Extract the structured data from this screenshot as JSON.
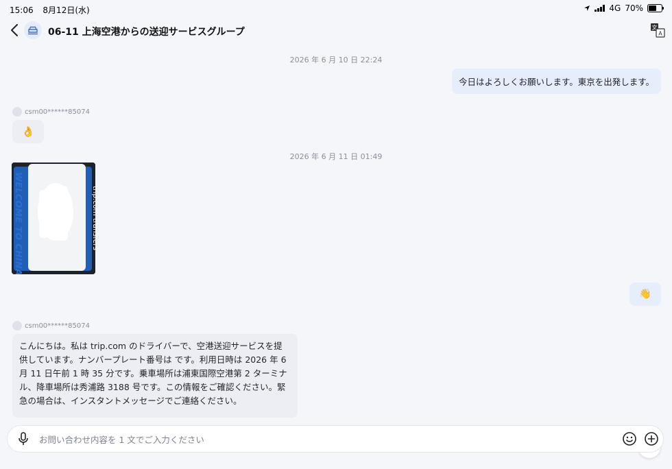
{
  "status_bar": {
    "time": "15:06",
    "date": "8月12日(水)",
    "network": "4G",
    "battery": "70%",
    "battery_level": 0.7
  },
  "header": {
    "title": "06-11 上海空港からの送迎サービスグループ",
    "back_icon": "chevron-left-icon",
    "translate_icon": "translate-icon"
  },
  "messages": {
    "ts1": "2026 年 6 月 10 日 22:24",
    "out1": "今日はよろしくお願いします。東京を出発します。",
    "sender1": "csm00******85074",
    "in1_emoji": "👌",
    "ts2": "2026 年 6 月 11 日 01:49",
    "photo": {
      "line1": "WELCOME TO CHINA",
      "line2": "trip.com transfers"
    },
    "out2_emoji": "👋",
    "sender2": "csm00******85074",
    "in2": "こんにちは。私は trip.com のドライバーで、空港送迎サービスを提供しています。ナンバープレート番号は  です。利用日時は 2026 年 6 月 11 日午前 1 時 35 分です。乗車場所は浦東国際空港第 2 ターミナル、降車場所は秀浦路 3188 号です。この情報をご確認ください。緊急の場合は、インスタントメッセージでご連絡ください。"
  },
  "composer": {
    "placeholder": "お問い合わせ内容を 1 文でご入力ください",
    "value": ""
  },
  "colors": {
    "outgoing_bubble": "#e6edfb",
    "incoming_bubble": "#eceef3",
    "background": "#f5f6fa"
  }
}
